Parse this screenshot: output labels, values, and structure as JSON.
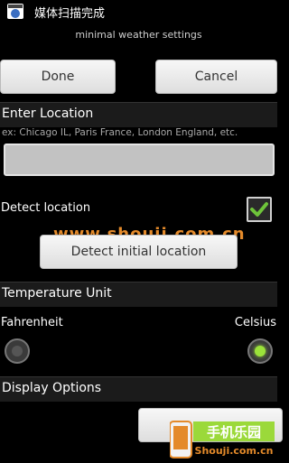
{
  "status_bar": {
    "notification_text": "媒体扫描完成",
    "icon": "media-scanner-icon"
  },
  "app_title": "minimal weather settings",
  "toolbar": {
    "done_label": "Done",
    "cancel_label": "Cancel"
  },
  "enter_location": {
    "header": "Enter Location",
    "hint": "ex: Chicago IL, Paris France, London England, etc.",
    "input_value": ""
  },
  "detect_location": {
    "label": "Detect location",
    "checked": true,
    "button_label": "Detect initial location"
  },
  "watermark": "www.shouji.com.cn",
  "temperature": {
    "header": "Temperature Unit",
    "options": [
      {
        "label": "Fahrenheit",
        "selected": false
      },
      {
        "label": "Celsius",
        "selected": true
      }
    ]
  },
  "display_options": {
    "header": "Display Options"
  },
  "logo": {
    "cn": "手机乐园",
    "en": "Shouji.com.cn"
  },
  "colors": {
    "accent_green": "#9be23a",
    "check_green": "#6ec43a",
    "watermark_orange": "#e48a2a"
  }
}
